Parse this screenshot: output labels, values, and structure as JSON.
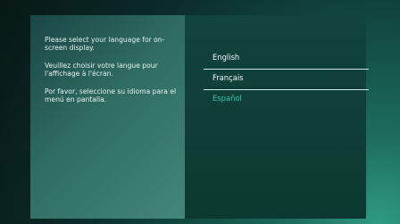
{
  "instructions": {
    "en": "Please select your language for on-screen display.",
    "fr": "Veuillez choisir votre langue pour l'affichage à l'écran.",
    "es": "Por favor, seleccione su idioma para el menú en pantalla."
  },
  "languages": [
    {
      "label": "English"
    },
    {
      "label": "Français"
    },
    {
      "label": "Español"
    }
  ],
  "colors": {
    "accent": "#2ec6a4",
    "text": "#f2f7f6"
  }
}
